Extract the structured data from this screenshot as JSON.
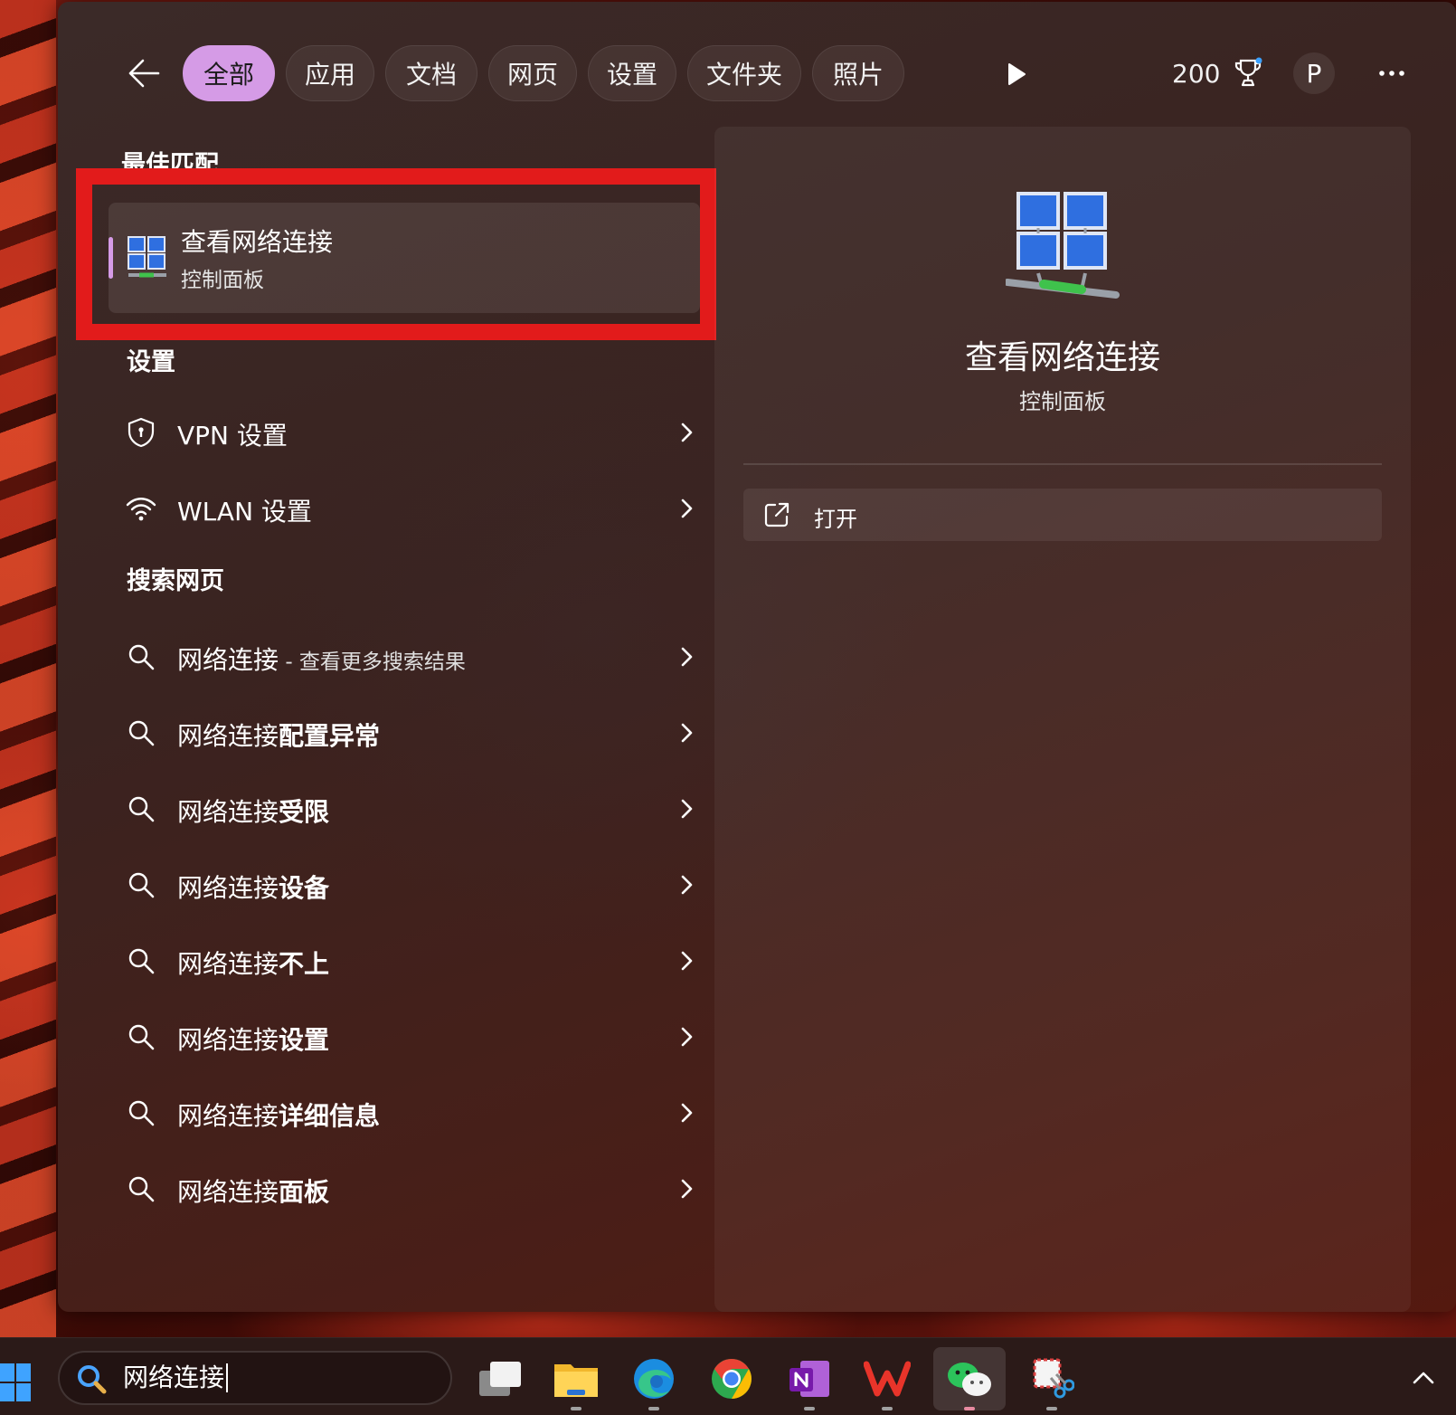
{
  "topbar": {
    "back_icon": "arrow-left-icon",
    "tabs": [
      "全部",
      "应用",
      "文档",
      "网页",
      "设置",
      "文件夹",
      "照片"
    ],
    "active_tab": "全部",
    "points": "200",
    "avatar_letter": "P"
  },
  "best_match": {
    "section": "最佳匹配",
    "title": "查看网络连接",
    "subtitle": "控制面板",
    "icon": "network-connections-icon"
  },
  "settings": {
    "section": "设置",
    "items": [
      {
        "label": "VPN 设置",
        "icon": "shield-icon"
      },
      {
        "label": "WLAN 设置",
        "icon": "wifi-icon"
      }
    ]
  },
  "web_search": {
    "section": "搜索网页",
    "first": {
      "query": "网络连接",
      "suffix": " - 查看更多搜索结果"
    },
    "items": [
      {
        "prefix": "网络连接",
        "bold": "配置异常"
      },
      {
        "prefix": "网络连接",
        "bold": "受限"
      },
      {
        "prefix": "网络连接",
        "bold": "设备"
      },
      {
        "prefix": "网络连接",
        "bold": "不上"
      },
      {
        "prefix": "网络连接",
        "bold": "设置"
      },
      {
        "prefix": "网络连接",
        "bold": "详细信息"
      },
      {
        "prefix": "网络连接",
        "bold": "面板"
      }
    ]
  },
  "detail": {
    "title": "查看网络连接",
    "subtitle": "控制面板",
    "open_label": "打开",
    "open_icon": "open-external-icon"
  },
  "taskbar": {
    "search_value": "网络连接",
    "apps": [
      "task-view",
      "file-explorer",
      "edge",
      "chrome",
      "onenote",
      "wps",
      "wechat",
      "snipping-tool"
    ],
    "active_app": "wechat"
  },
  "colors": {
    "accent": "#d59be6",
    "highlight_box": "#e21b1b"
  }
}
